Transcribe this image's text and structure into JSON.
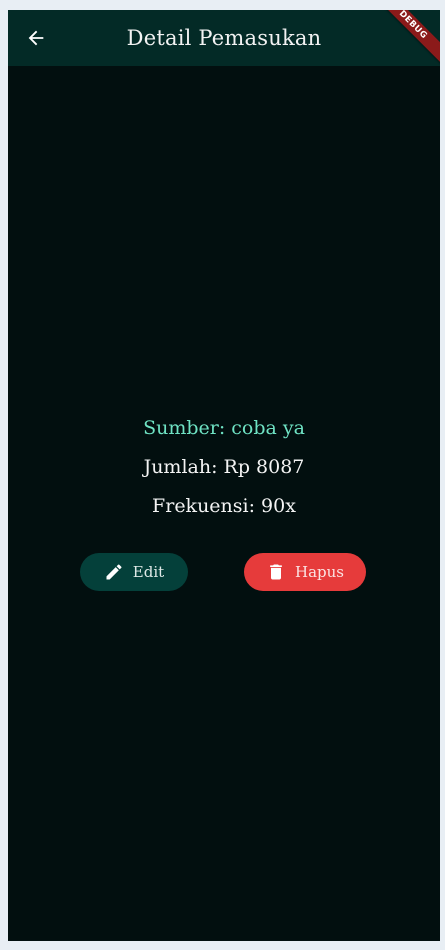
{
  "appbar": {
    "title": "Detail Pemasukan",
    "back_icon": "arrow-left-icon"
  },
  "debug_banner": {
    "label": "DEBUG"
  },
  "detail": {
    "source": "Sumber: coba ya",
    "amount": "Jumlah: Rp 8087",
    "frequency": "Frekuensi: 90x"
  },
  "actions": {
    "edit_label": "Edit",
    "edit_icon": "pencil-icon",
    "delete_label": "Hapus",
    "delete_icon": "trash-icon"
  },
  "colors": {
    "background": "#020f0f",
    "appbar": "#032a26",
    "source_text": "#6fe3c4",
    "edit_button": "#04403a",
    "delete_button": "#e63b3b"
  }
}
